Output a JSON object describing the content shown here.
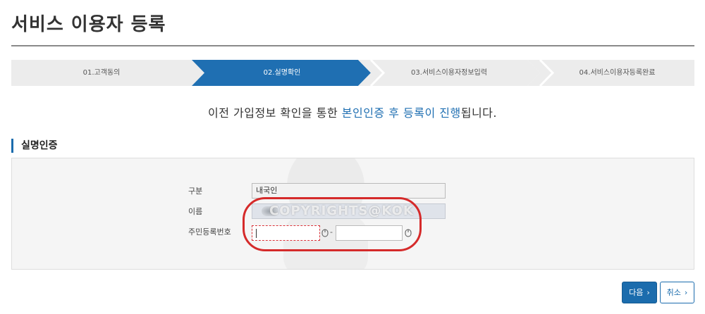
{
  "page": {
    "title": "서비스 이용자 등록"
  },
  "steps": [
    {
      "label": "01.고객동의",
      "active": false
    },
    {
      "label": "02.실명확인",
      "active": true
    },
    {
      "label": "03.서비스이용자정보입력",
      "active": false
    },
    {
      "label": "04.서비스이용자등록완료",
      "active": false
    }
  ],
  "colors": {
    "accent": "#1b6cad",
    "active_step": "#1f6fb2",
    "inactive_step": "#ececec",
    "highlight_ring": "#d52a2a"
  },
  "intro": {
    "prefix": "이전 가입정보 확인을 통한 ",
    "highlight": "본인인증 후 등록이 진행",
    "suffix": "됩니다."
  },
  "section": {
    "title": "실명인증"
  },
  "form": {
    "type_label": "구분",
    "type_value": "내국인",
    "name_label": "이름",
    "name_value": "",
    "id_label": "주민등록번호",
    "id_first_value": "",
    "id_second_value": "",
    "separator": "-",
    "watermark_text": "COPYRIGHTS@KOK"
  },
  "buttons": {
    "next_label": "다음",
    "cancel_label": "취소",
    "chevron": "›"
  }
}
